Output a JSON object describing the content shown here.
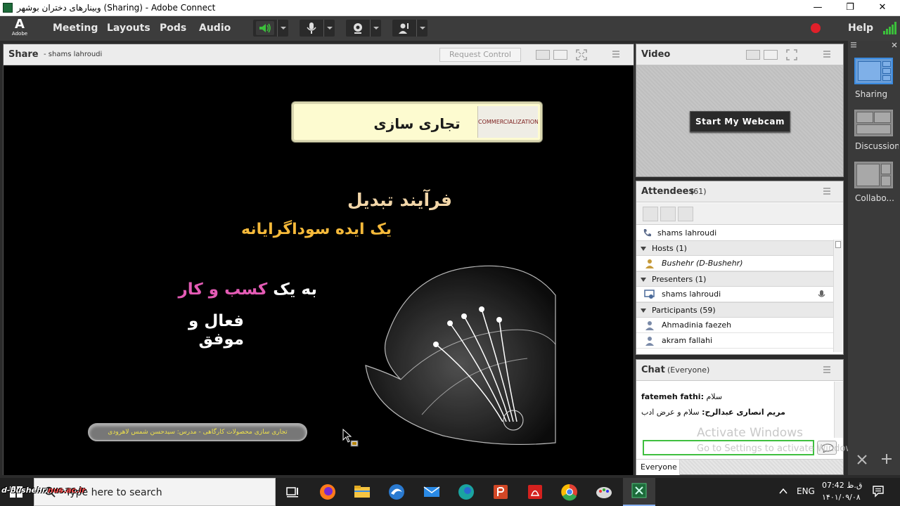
{
  "window": {
    "title": "وبینارهای دختران بوشهر (Sharing) - Adobe Connect",
    "minimize": "—",
    "maximize": "❐",
    "close": "✕"
  },
  "menubar": {
    "logo_mark": "A",
    "logo_text": "Adobe",
    "items": [
      "Meeting",
      "Layouts",
      "Pods",
      "Audio"
    ],
    "help": "Help",
    "accent_color": "#3bbf3b",
    "record_color": "#e0202a"
  },
  "share_pod": {
    "title": "Share",
    "presenter": "- shams lahroudi",
    "request_control": "Request Control",
    "slide": {
      "title": "تجاری سازی",
      "title_image_text": "COMMERCIALIZATION",
      "line1": "فرآیند تبدیل",
      "line2": "یک ایده سوداگرایانه",
      "line3_prefix": "به یک",
      "line3_highlight": "کسب و کار",
      "line4": "فعال و موفق",
      "footer": "تجاری سازی محصولات کارگاهی - مدرس: سیدحسن شمس لاهرودی"
    }
  },
  "video_pod": {
    "title": "Video",
    "start_webcam": "Start My Webcam"
  },
  "attendees_pod": {
    "title": "Attendees",
    "count": "(61)",
    "speaking": "shams lahroudi",
    "hosts_group": "Hosts (1)",
    "host": "Bushehr (D-Bushehr)",
    "presenters_group": "Presenters (1)",
    "presenter": "shams lahroudi",
    "participants_group": "Participants (59)",
    "participants": [
      "Ahmadinia faezeh",
      "akram fallahi"
    ]
  },
  "chat_pod": {
    "title": "Chat",
    "scope": "(Everyone)",
    "messages": [
      {
        "sender": "fatemeh fathi:",
        "text": "سلام"
      },
      {
        "sender": "مریم انصاری عبدالرح:",
        "text": "سلام و عرض ادب"
      }
    ],
    "footer_tab": "Everyone"
  },
  "watermark": {
    "line1": "Activate Windows",
    "line2": "Go to Settings to activate Windows."
  },
  "layouts_panel": {
    "items": [
      "Sharing",
      "Discussion",
      "Collabo..."
    ],
    "active_color": "#3b8be0"
  },
  "taskbar": {
    "search_placeholder": "Type here to search",
    "overlay_url_prefix": "d-bushehr.",
    "overlay_url_domain": "nus.ac.ir",
    "language": "ENG",
    "time": "07:42 ق.ظ",
    "date": "۱۴۰۱/۰۹/۰۸",
    "apps": [
      "task-view",
      "firefox",
      "file-explorer",
      "edge-legacy",
      "mail",
      "edge",
      "powerpoint",
      "acrobat",
      "chrome",
      "paint",
      "adobe-connect"
    ]
  }
}
